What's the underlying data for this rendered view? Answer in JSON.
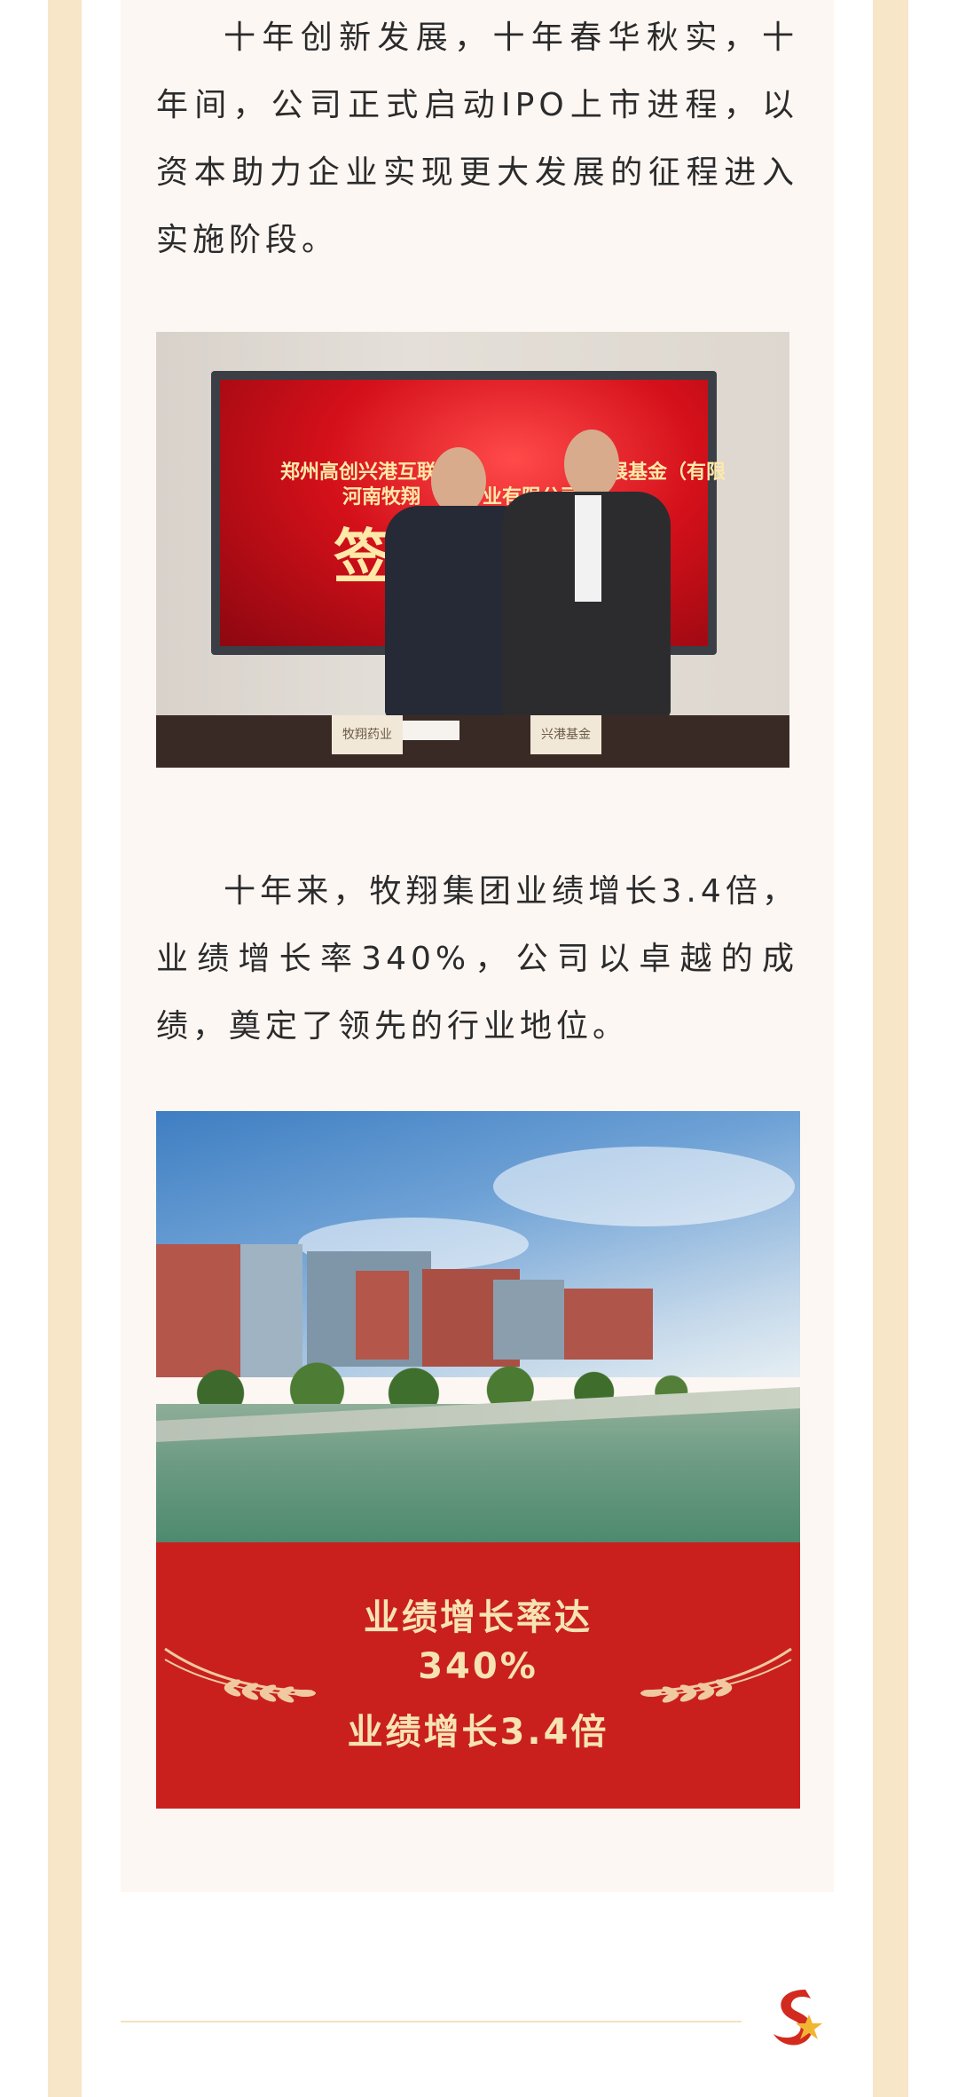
{
  "article": {
    "paragraph1": "十年创新发展，十年春华秋实，十年间，公司正式启动IPO上市进程，以资本助力企业实现更大发展的征程进入实施阶段。",
    "paragraph2": "十年来，牧翔集团业绩增长3.4倍，业绩增长率340%，公司以卓越的成绩，奠定了领先的行业地位。"
  },
  "photo1": {
    "screen_line1": "郑州高创兴港互联网",
    "screen_line1b": "发展基金（有限",
    "screen_line2": "河南牧翔",
    "screen_line2b": "业有限公司",
    "screen_big": "签 式",
    "nameplate_left": "牧翔药业",
    "nameplate_right": "兴港基金"
  },
  "banner": {
    "line1": "业绩增长率达",
    "line2": "340%",
    "line3": "业绩增长3.4倍"
  },
  "colors": {
    "frame": "#f8e6c9",
    "card": "#fdf7f4",
    "banner_red": "#c9201d",
    "banner_text": "#f6e3b4"
  }
}
